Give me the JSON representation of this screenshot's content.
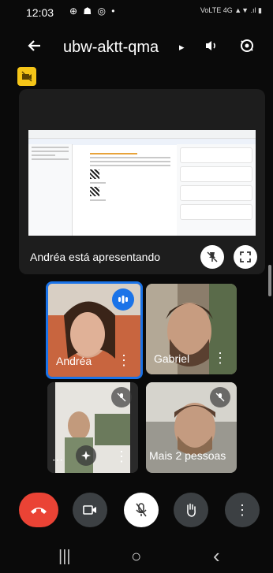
{
  "status": {
    "time": "12:03",
    "left_icons": "⊕ ☗ ◎ •",
    "right_icons": "VoLTE 4G ▲▼ .ıl ▮"
  },
  "header": {
    "meeting_code": "ubw-aktt-qma",
    "chevron": "▸",
    "back_icon": "arrow-left",
    "speaker_icon": "speaker",
    "switch_icon": "switch-camera"
  },
  "presentation": {
    "label": "Andréa está apresentando",
    "pin_icon": "unpin",
    "fullscreen_icon": "fullscreen"
  },
  "participants": [
    {
      "name": "Andréa",
      "state": "speaking"
    },
    {
      "name": "Gabriel",
      "state": "normal"
    },
    {
      "name": "",
      "state": "muted"
    },
    {
      "name": "Mais 2 pessoas",
      "state": "muted"
    }
  ],
  "controls": {
    "end_call_color": "#ea4335",
    "items": [
      "end-call",
      "camera",
      "mic-off",
      "raise-hand",
      "more"
    ]
  },
  "navbar": {
    "recent": "|||",
    "home": "○",
    "back": "‹"
  }
}
